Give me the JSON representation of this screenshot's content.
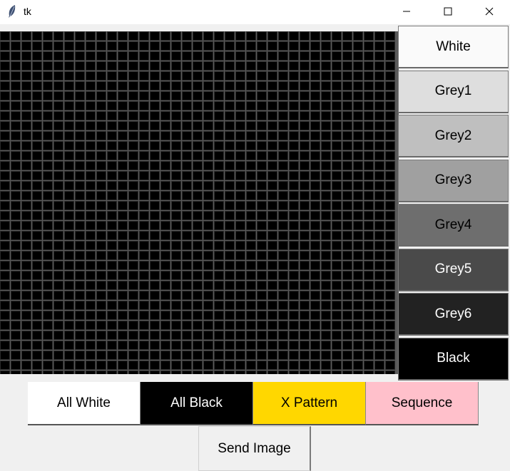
{
  "window": {
    "title": "tk",
    "icon": "feather-icon",
    "controls": [
      "minimize-icon",
      "maximize-icon",
      "close-icon"
    ]
  },
  "canvas": {
    "cell_color": "#000000",
    "grid_line_color": "#5a5a5a"
  },
  "palette": {
    "items": [
      {
        "label": "White",
        "bg": "#fafafa",
        "fg": "#000000"
      },
      {
        "label": "Grey1",
        "bg": "#dedede",
        "fg": "#000000"
      },
      {
        "label": "Grey2",
        "bg": "#bfbfbf",
        "fg": "#000000"
      },
      {
        "label": "Grey3",
        "bg": "#a0a0a0",
        "fg": "#000000"
      },
      {
        "label": "Grey4",
        "bg": "#6e6e6e",
        "fg": "#000000"
      },
      {
        "label": "Grey5",
        "bg": "#4a4a4a",
        "fg": "#ffffff"
      },
      {
        "label": "Grey6",
        "bg": "#222222",
        "fg": "#ffffff"
      },
      {
        "label": "Black",
        "bg": "#000000",
        "fg": "#ffffff"
      }
    ]
  },
  "actions": {
    "items": [
      {
        "label": "All White",
        "bg": "#ffffff",
        "fg": "#000000"
      },
      {
        "label": "All Black",
        "bg": "#000000",
        "fg": "#ffffff"
      },
      {
        "label": "X Pattern",
        "bg": "#ffd700",
        "fg": "#000000"
      },
      {
        "label": "Sequence",
        "bg": "#ffc0cb",
        "fg": "#000000"
      }
    ],
    "send_label": "Send Image"
  }
}
